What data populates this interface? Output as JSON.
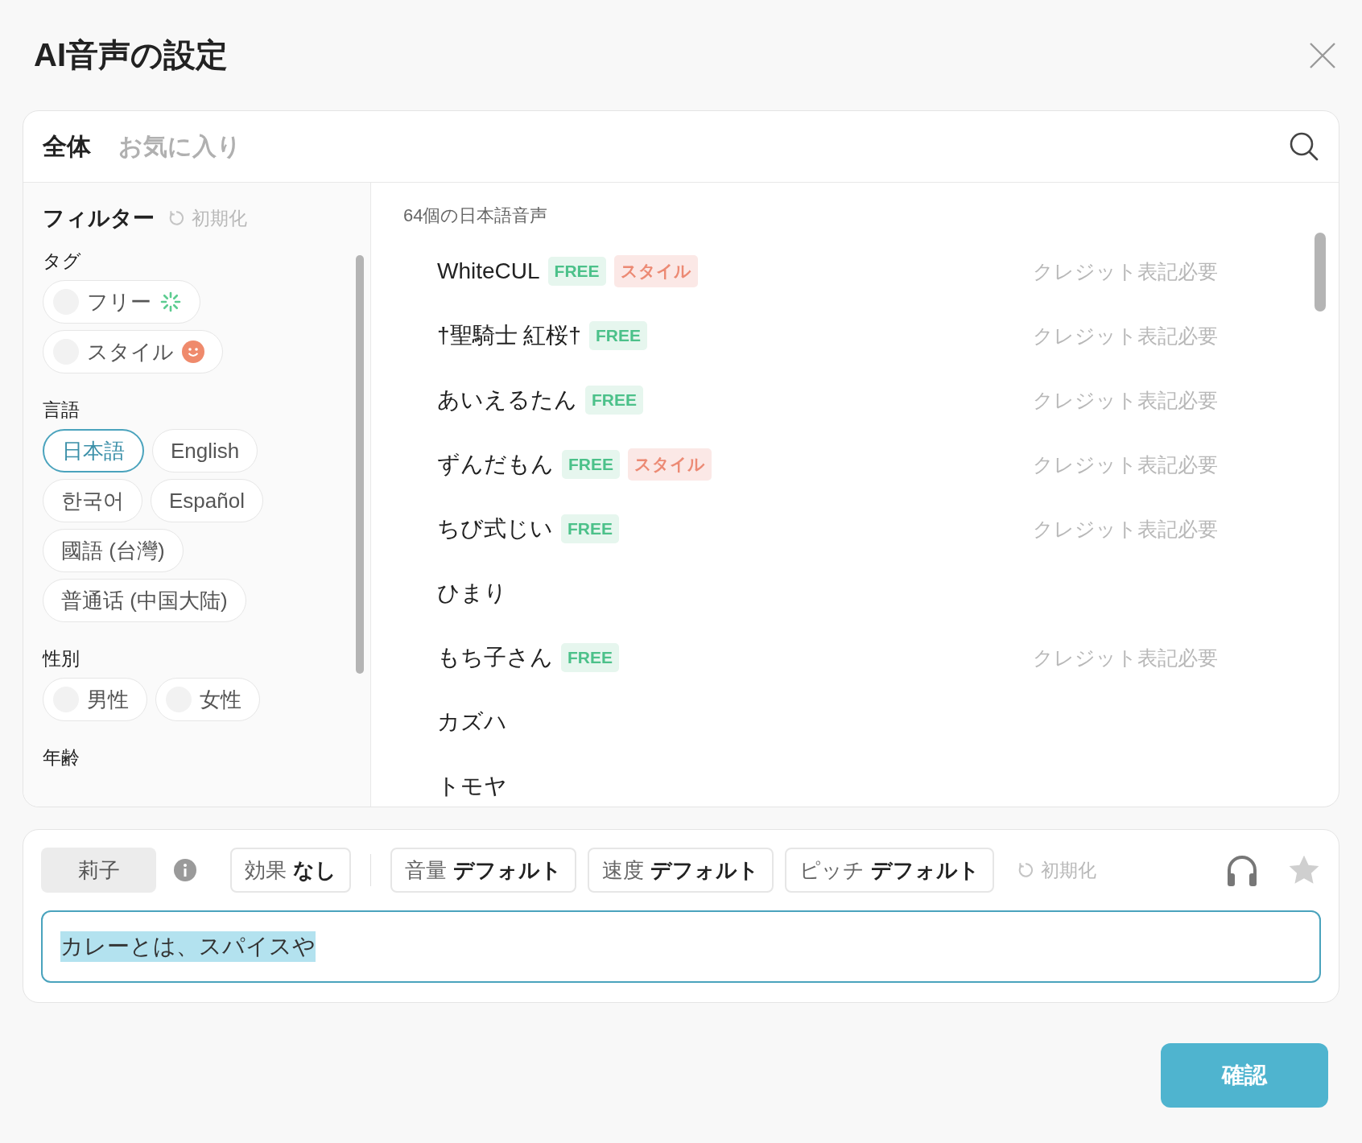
{
  "dialog": {
    "title": "AI音声の設定"
  },
  "tabs": [
    {
      "label": "全体",
      "selected": true
    },
    {
      "label": "お気に入り",
      "selected": false
    }
  ],
  "filter": {
    "title": "フィルター",
    "reset": "初期化",
    "groups": [
      {
        "label": "タグ",
        "chips": [
          {
            "label": "フリー",
            "kind": "free_tag",
            "checked": false
          },
          {
            "label": "スタイル",
            "kind": "style_tag",
            "checked": false
          }
        ]
      },
      {
        "label": "言語",
        "chips": [
          {
            "label": "日本語",
            "kind": "plain",
            "selected": true
          },
          {
            "label": "English",
            "kind": "plain",
            "selected": false
          },
          {
            "label": "한국어",
            "kind": "plain",
            "selected": false
          },
          {
            "label": "Español",
            "kind": "plain",
            "selected": false
          },
          {
            "label": "國語 (台灣)",
            "kind": "plain",
            "selected": false
          },
          {
            "label": "普通话 (中国大陆)",
            "kind": "plain",
            "selected": false
          }
        ]
      },
      {
        "label": "性別",
        "chips": [
          {
            "label": "男性",
            "kind": "check",
            "checked": false
          },
          {
            "label": "女性",
            "kind": "check",
            "checked": false
          }
        ]
      },
      {
        "label": "年齢"
      }
    ]
  },
  "voices": {
    "count": "64個の日本語音声",
    "items": [
      {
        "name": "WhiteCUL",
        "badges": [
          {
            "label": "FREE",
            "kind": "free"
          },
          {
            "label": "スタイル",
            "kind": "style"
          }
        ],
        "note": "クレジット表記必要"
      },
      {
        "name": "†聖騎士 紅桜†",
        "badges": [
          {
            "label": "FREE",
            "kind": "free"
          }
        ],
        "note": "クレジット表記必要"
      },
      {
        "name": "あいえるたん",
        "badges": [
          {
            "label": "FREE",
            "kind": "free"
          }
        ],
        "note": "クレジット表記必要"
      },
      {
        "name": "ずんだもん",
        "badges": [
          {
            "label": "FREE",
            "kind": "free"
          },
          {
            "label": "スタイル",
            "kind": "style"
          }
        ],
        "note": "クレジット表記必要"
      },
      {
        "name": "ちび式じい",
        "badges": [
          {
            "label": "FREE",
            "kind": "free"
          }
        ],
        "note": "クレジット表記必要"
      },
      {
        "name": "ひまり"
      },
      {
        "name": "もち子さん",
        "badges": [
          {
            "label": "FREE",
            "kind": "free"
          }
        ],
        "note": "クレジット表記必要"
      },
      {
        "name": "カズハ"
      },
      {
        "name": "トモヤ"
      }
    ]
  },
  "settings": {
    "voice": "莉子",
    "effect": {
      "label": "効果",
      "value": "なし"
    },
    "params": [
      {
        "label": "音量",
        "value": "デフォルト"
      },
      {
        "label": "速度",
        "value": "デフォルト"
      },
      {
        "label": "ピッチ",
        "value": "デフォルト"
      }
    ],
    "reset": "初期化",
    "favorite": false,
    "text": {
      "value": "カレーとは、スパイスや",
      "selected": true
    }
  },
  "confirm": "確認"
}
